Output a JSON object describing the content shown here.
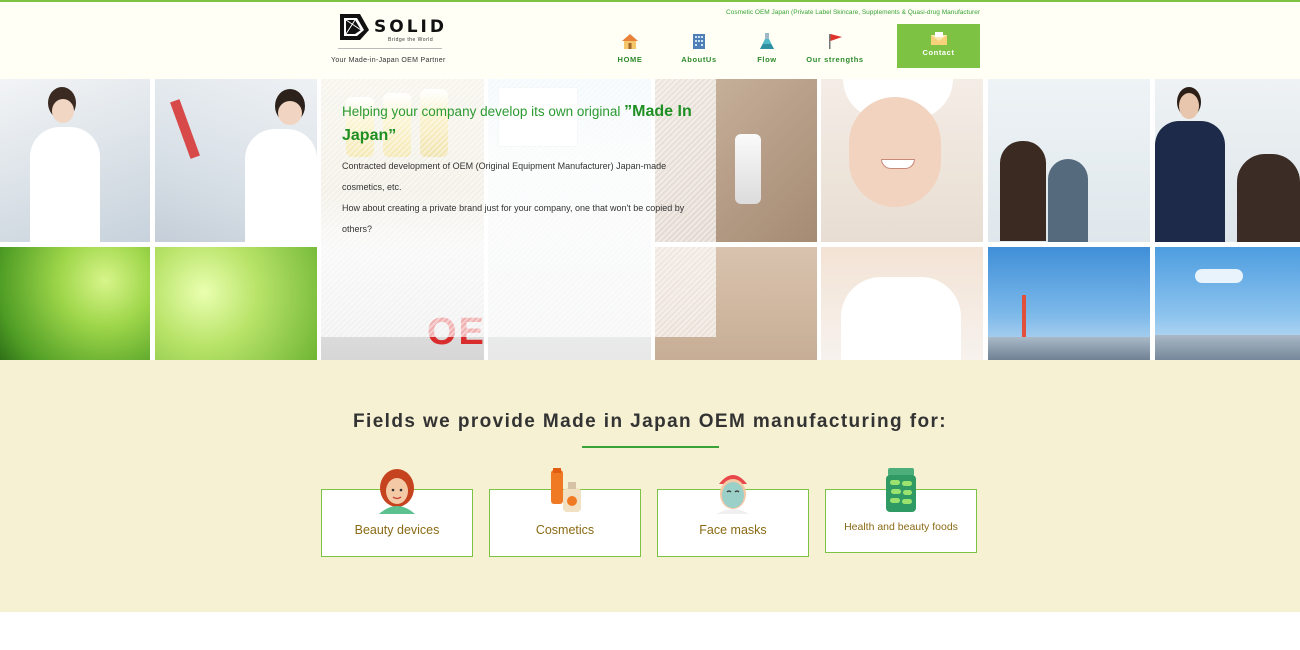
{
  "header": {
    "logo_text": "SOLID",
    "logo_subtext": "Bridge the World",
    "tagline": "Your Made-in-Japan OEM Partner",
    "top_note": "Cosmetic OEM Japan (Private Label Skincare, Supplements & Quasi-drug Manufacturer",
    "nav": [
      {
        "label": "HOME",
        "icon": "house-icon"
      },
      {
        "label": "AboutUs",
        "icon": "building-icon"
      },
      {
        "label": "Flow",
        "icon": "flask-icon"
      },
      {
        "label": "Our strengths",
        "icon": "flag-icon"
      }
    ],
    "contact_label": "Contact",
    "contact_icon": "envelope-icon"
  },
  "hero": {
    "title_prefix": "Helping your company develop its own original ",
    "title_emphasis": "”Made In Japan”",
    "lines": [
      "Contracted development of OEM (Original Equipment Manufacturer) Japan-made cosmetics, etc.",
      "How about creating a private brand just for your company, one that won't be copied by others?"
    ],
    "photo_text": "OEM"
  },
  "fields": {
    "title": "Fields we provide Made in Japan OEM manufacturing for:",
    "items": [
      {
        "label": "Beauty devices",
        "icon": "woman-face-icon"
      },
      {
        "label": "Cosmetics",
        "icon": "cosmetic-bottles-icon"
      },
      {
        "label": "Face masks",
        "icon": "face-mask-icon"
      },
      {
        "label": "Health and beauty foods",
        "icon": "supplement-jar-icon"
      }
    ]
  },
  "colors": {
    "accent_green": "#7dc242",
    "dark_green": "#2e8b2b",
    "header_bg": "#fffff6",
    "fields_bg": "#f6f1d3",
    "card_label": "#8a6a14"
  }
}
